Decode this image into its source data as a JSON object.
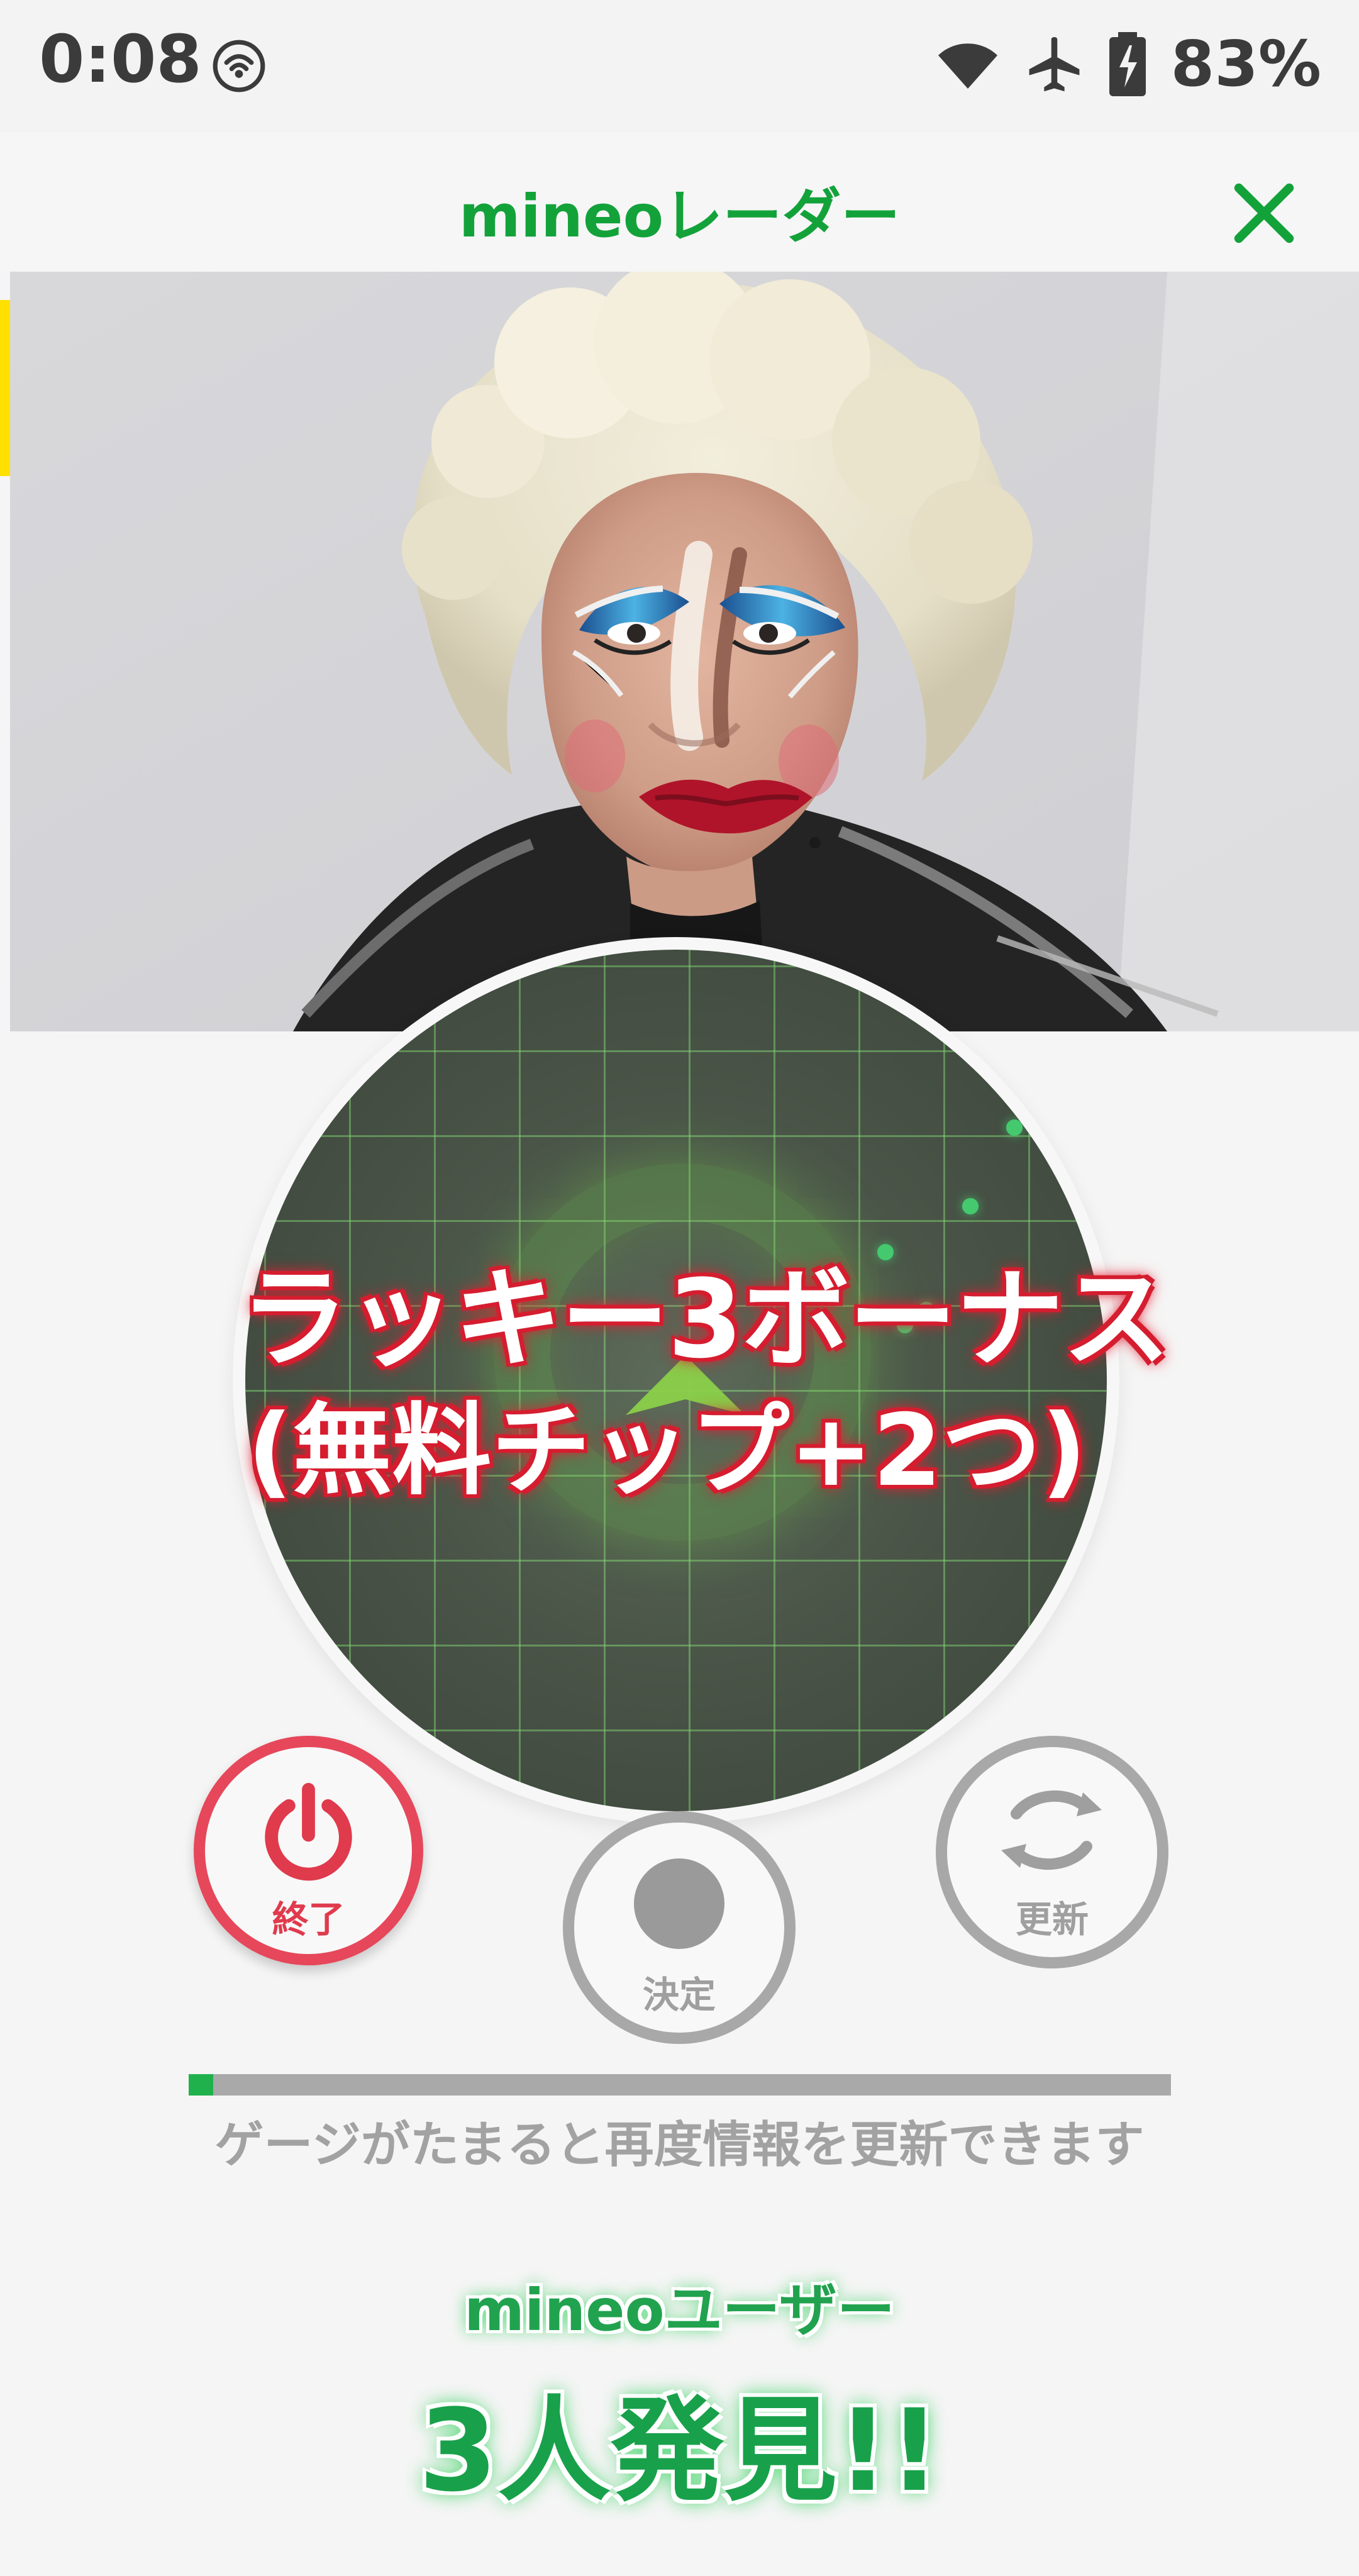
{
  "status_bar": {
    "time": "0:08",
    "battery": "83%",
    "icons": [
      "hotspot-icon",
      "wifi-icon",
      "airplane-icon",
      "battery-charging-icon"
    ]
  },
  "header": {
    "title": "mineoレーダー",
    "close_icon": "close-icon"
  },
  "hero": {
    "image_icon": "portrait-photo"
  },
  "radar": {
    "bonus_line_1": "ラッキー3ボーナス",
    "bonus_line_2": "(無料チップ+2つ)",
    "arrow_icon": "direction-arrow-icon"
  },
  "controls": {
    "end_label": "終了",
    "decide_label": "決定",
    "refresh_label": "更新"
  },
  "gauge": {
    "progress": 0.025,
    "message": "ゲージがたまると再度情報を更新できます"
  },
  "result": {
    "title": "mineoユーザー",
    "count_text": "3人発見!!"
  },
  "colors": {
    "brand_green": "#13a23a",
    "danger_red": "#e6475a",
    "gray": "#a8a8a8"
  }
}
